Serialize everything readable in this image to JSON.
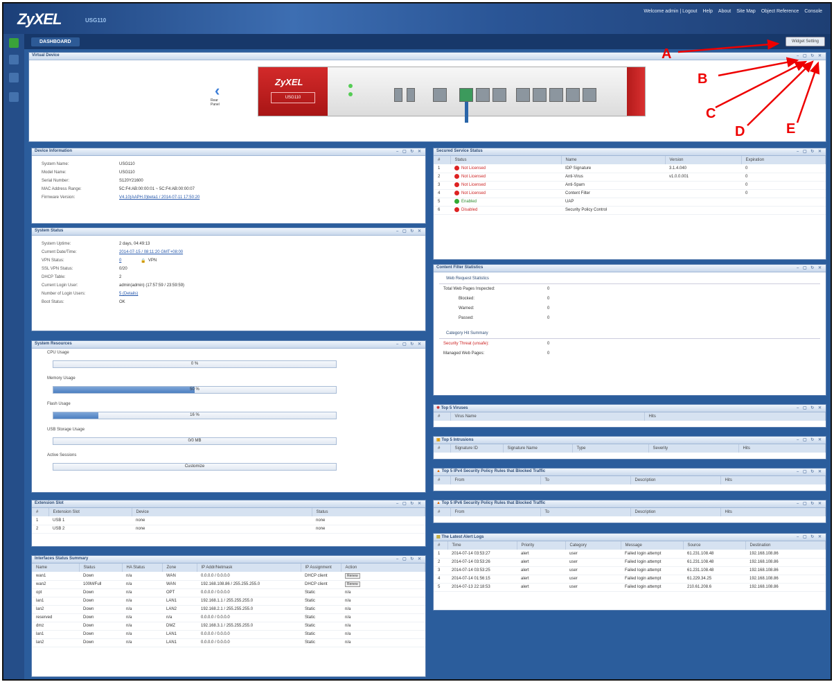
{
  "header": {
    "logo": "ZyXEL",
    "model": "USG110",
    "links": [
      "Welcome admin | Logout",
      "Help",
      "About",
      "Site Map",
      "Object Reference",
      "Console"
    ]
  },
  "nav": {
    "tab": "DASHBOARD",
    "widget_button": "Widget Setting"
  },
  "virtual_device": {
    "title": "Virtual Device",
    "back_label": "Rear Panel",
    "brand": "ZyXEL",
    "model_label": "USG110"
  },
  "device_info": {
    "title": "Device Information",
    "rows": [
      {
        "k": "System Name:",
        "v": "USG110"
      },
      {
        "k": "Model Name:",
        "v": "USG110"
      },
      {
        "k": "Serial Number:",
        "v": "S120Y21600"
      },
      {
        "k": "MAC Address Range:",
        "v": "5C:F4:AB:00:00:01 ~ 5C:F4:AB:00:00:07"
      },
      {
        "k": "Firmware Version:",
        "v": "V4.10(AAPH.0)beta1 / 2014-07-11 17:50:20"
      }
    ]
  },
  "system_status": {
    "title": "System Status",
    "rows": [
      {
        "k": "System Uptime:",
        "v": "2 days, 04:49:13"
      },
      {
        "k": "Current Date/Time:",
        "v": "2014-07-15 / 08:11:20 GMT+08:00"
      },
      {
        "k": "VPN Status:",
        "v": "0"
      },
      {
        "k": "SSL VPN Status:",
        "v": "0/20"
      },
      {
        "k": "DHCP Table:",
        "v": "2"
      },
      {
        "k": "Current Login User:",
        "v": "admin(admin) (17:57:59 / 23:59:59)"
      },
      {
        "k": "Number of Login Users:",
        "v": "5 (Details)"
      },
      {
        "k": "Boot Status:",
        "v": "OK"
      }
    ],
    "vpn_label": "VPN"
  },
  "system_resources": {
    "title": "System Resources",
    "cpu_label": "CPU Usage",
    "cpu_value": "0 %",
    "cpu_pct": 0,
    "mem_label": "Memory Usage",
    "mem_value": "50 %",
    "mem_pct": 50,
    "flash_label": "Flash Usage",
    "flash_value": "16 %",
    "flash_pct": 16,
    "usb_label": "USB Storage Usage",
    "usb_value": "0/0 MB",
    "sessions_label": "Active Sessions",
    "sessions_value": "Customize"
  },
  "extension_slot": {
    "title": "Extension Slot",
    "headers": [
      "#",
      "Extension Slot",
      "Device",
      "Status"
    ],
    "rows": [
      [
        "1",
        "USB 1",
        "none",
        "none"
      ],
      [
        "2",
        "USB 2",
        "none",
        "none"
      ]
    ]
  },
  "interfaces": {
    "title": "Interfaces Status Summary",
    "headers": [
      "Name",
      "Status",
      "HA Status",
      "Zone",
      "IP Addr/Netmask",
      "IP Assignment",
      "Action"
    ],
    "rows": [
      [
        "wan1",
        "Down",
        "n/a",
        "WAN",
        "0.0.0.0 / 0.0.0.0",
        "DHCP client",
        "Renew"
      ],
      [
        "wan2",
        "100M/Full",
        "n/a",
        "WAN",
        "192.168.108.86 / 255.255.255.0",
        "DHCP client",
        "Renew"
      ],
      [
        "opt",
        "Down",
        "n/a",
        "OPT",
        "0.0.0.0 / 0.0.0.0",
        "Static",
        "n/a"
      ],
      [
        "lan1",
        "Down",
        "n/a",
        "LAN1",
        "192.168.1.1 / 255.255.255.0",
        "Static",
        "n/a"
      ],
      [
        "lan2",
        "Down",
        "n/a",
        "LAN2",
        "192.168.2.1 / 255.255.255.0",
        "Static",
        "n/a"
      ],
      [
        "reserved",
        "Down",
        "n/a",
        "n/a",
        "0.0.0.0 / 0.0.0.0",
        "Static",
        "n/a"
      ],
      [
        "dmz",
        "Down",
        "n/a",
        "DMZ",
        "192.168.3.1 / 255.255.255.0",
        "Static",
        "n/a"
      ],
      [
        "lan1",
        "Down",
        "n/a",
        "LAN1",
        "0.0.0.0 / 0.0.0.0",
        "Static",
        "n/a"
      ],
      [
        "lan2",
        "Down",
        "n/a",
        "LAN1",
        "0.0.0.0 / 0.0.0.0",
        "Static",
        "n/a"
      ]
    ]
  },
  "licensed": {
    "title": "Secured Service Status",
    "headers": [
      "#",
      "Status",
      "Name",
      "Version",
      "Expiration"
    ],
    "rows": [
      [
        "1",
        "Not Licensed",
        "IDP Signature",
        "3.1.4.040",
        "0"
      ],
      [
        "2",
        "Not Licensed",
        "Anti-Virus",
        "v1.0.0.001",
        "0"
      ],
      [
        "3",
        "Not Licensed",
        "Anti-Spam",
        "",
        "0"
      ],
      [
        "4",
        "Not Licensed",
        "Content Filter",
        "",
        "0"
      ],
      [
        "5",
        "Enabled",
        "UAP",
        "",
        ""
      ],
      [
        "6",
        "Disabled",
        "Security Policy Control",
        "",
        ""
      ]
    ]
  },
  "content_filter": {
    "title": "Content Filter Statistics",
    "web_section": "Web Request Statistics",
    "web_rows": [
      {
        "k": "Total Web Pages Inspected:",
        "v": "0"
      },
      {
        "k": "Blocked:",
        "v": "0"
      },
      {
        "k": "Warned:",
        "v": "0"
      },
      {
        "k": "Passed:",
        "v": "0"
      }
    ],
    "cat_section": "Category Hit Summary",
    "cat_rows": [
      {
        "k": "Security Threat (unsafe):",
        "v": "0"
      },
      {
        "k": "Managed Web Pages:",
        "v": "0"
      }
    ]
  },
  "top5_viruses": {
    "title": "Top 5 Viruses",
    "headers": [
      "#",
      "Virus Name",
      "Hits"
    ]
  },
  "top5_intrusions": {
    "title": "Top 5 Intrusions",
    "headers": [
      "#",
      "Signature ID",
      "Signature Name",
      "Type",
      "Severity",
      "Hits"
    ]
  },
  "top5_ipv4": {
    "title": "Top 5 IPv4 Security Policy Rules that Blocked Traffic",
    "headers": [
      "#",
      "From",
      "To",
      "Description",
      "Hits"
    ]
  },
  "top5_ipv6": {
    "title": "Top 5 IPv6 Security Policy Rules that Blocked Traffic",
    "headers": [
      "#",
      "From",
      "To",
      "Description",
      "Hits"
    ]
  },
  "alert_logs": {
    "title": "The Latest Alert Logs",
    "headers": [
      "#",
      "Time",
      "Priority",
      "Category",
      "Message",
      "Source",
      "Destination"
    ],
    "rows": [
      [
        "1",
        "2014-07-14 03:53:27",
        "alert",
        "user",
        "Failed login attempt",
        "61.231.108.48",
        "192.168.108.86"
      ],
      [
        "2",
        "2014-07-14 03:53:26",
        "alert",
        "user",
        "Failed login attempt",
        "61.231.108.48",
        "192.168.108.86"
      ],
      [
        "3",
        "2014-07-14 03:53:25",
        "alert",
        "user",
        "Failed login attempt",
        "61.231.108.48",
        "192.168.108.86"
      ],
      [
        "4",
        "2014-07-14 01:56:15",
        "alert",
        "user",
        "Failed login attempt",
        "61.229.34.25",
        "192.168.108.86"
      ],
      [
        "5",
        "2014-07-13 22:18:53",
        "alert",
        "user",
        "Failed login attempt",
        "210.61.208.6",
        "192.168.108.86"
      ]
    ]
  },
  "callouts": {
    "a": "A",
    "b": "B",
    "c": "C",
    "d": "D",
    "e": "E"
  },
  "colors": {
    "accent": "#2b5d9c",
    "callout": "#ee0000"
  }
}
